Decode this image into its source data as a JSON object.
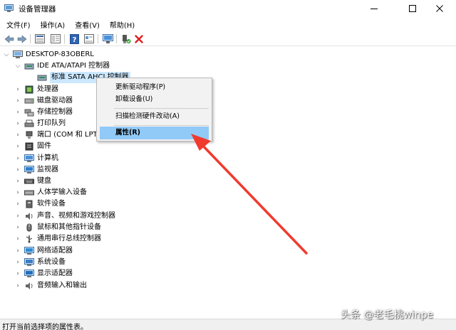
{
  "window": {
    "title": "设备管理器",
    "controls": [
      "minimize-icon",
      "maximize-icon",
      "close-icon"
    ]
  },
  "menubar": {
    "items": [
      "文件(F)",
      "操作(A)",
      "查看(V)",
      "帮助(H)"
    ]
  },
  "toolbar": {
    "buttons": [
      "back-icon",
      "forward-icon",
      "properties-icon",
      "show-hide-console-icon",
      "help-icon",
      "view-icon",
      "scan-hardware-icon",
      "enable-device-icon",
      "uninstall-device-icon"
    ]
  },
  "tree": {
    "root": "DESKTOP-83OBERL",
    "ide_category": "IDE ATA/ATAPI 控制器",
    "ide_child": "标准 SATA AHCI 控制器",
    "categories": [
      "处理器",
      "磁盘驱动器",
      "存储控制器",
      "打印队列",
      "端口 (COM 和 LPT)",
      "固件",
      "计算机",
      "监视器",
      "键盘",
      "人体学输入设备",
      "软件设备",
      "声音、视频和游戏控制器",
      "鼠标和其他指针设备",
      "通用串行总线控制器",
      "网络适配器",
      "系统设备",
      "显示适配器",
      "音频输入和输出"
    ]
  },
  "context_menu": {
    "items": [
      "更新驱动程序(P)",
      "卸载设备(U)",
      "扫描检测硬件改动(A)",
      "属性(R)"
    ]
  },
  "statusbar": {
    "text": "打开当前选择项的属性表。"
  },
  "watermark": {
    "text": "头条 @老毛桃winpe"
  },
  "colors": {
    "selection": "#cce8ff",
    "menu_highlight": "#91c9f7",
    "annotation_arrow": "#f03a2e"
  }
}
